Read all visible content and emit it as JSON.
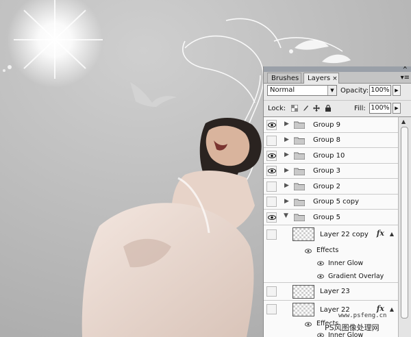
{
  "panel": {
    "tabs": [
      {
        "label": "Brushes"
      },
      {
        "label": "Layers",
        "close": "×",
        "active": true
      }
    ],
    "menu_icon": "panel-menu-icon",
    "blend_mode": "Normal",
    "opacity_label": "Opacity:",
    "opacity_value": "100%",
    "lock_label": "Lock:",
    "fill_label": "Fill:",
    "fill_value": "100%",
    "lock_icons": [
      "lock-transparent-icon",
      "lock-brush-icon",
      "lock-move-icon",
      "lock-all-icon"
    ]
  },
  "layers": {
    "groups": [
      {
        "name": "Group 9",
        "visible": true
      },
      {
        "name": "Group 8",
        "visible": false
      },
      {
        "name": "Group 10",
        "visible": true
      },
      {
        "name": "Group 3",
        "visible": true
      },
      {
        "name": "Group 2",
        "visible": false
      },
      {
        "name": "Group 5 copy",
        "visible": false
      },
      {
        "name": "Group 5",
        "visible": true,
        "expanded": true
      }
    ],
    "layer_22_copy": {
      "name": "Layer 22 copy",
      "fx": "fx",
      "effects_label": "Effects",
      "effects": [
        "Inner Glow",
        "Gradient Overlay"
      ]
    },
    "layer_23": {
      "name": "Layer 23"
    },
    "layer_22": {
      "name": "Layer 22",
      "fx": "fx",
      "effects_label": "Effects",
      "effects": [
        "Inner Glow"
      ]
    }
  },
  "watermark": {
    "url": "www.psfeng.cn",
    "name": "PS风图像处理网"
  },
  "colors": {
    "canvas_bg": "#b9b9b9",
    "panel_bg": "#e9e9e9",
    "list_bg": "#fafafa"
  }
}
